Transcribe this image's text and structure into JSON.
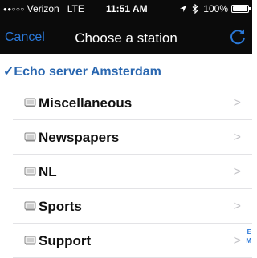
{
  "status_bar": {
    "signal_dots": "●●○○○",
    "carrier": "Verizon",
    "network": "LTE",
    "time": "11:51 AM",
    "location_icon": "location-arrow-icon",
    "bluetooth_icon": "bluetooth-icon",
    "battery": "100%",
    "battery_level": 1.0
  },
  "nav": {
    "cancel_label": "Cancel",
    "title": "Choose a station",
    "refresh_icon": "refresh-icon"
  },
  "group": {
    "checkmark": "✓",
    "title": "Echo server Amsterdam"
  },
  "items": [
    {
      "label": "Miscellaneous"
    },
    {
      "label": "Newspapers"
    },
    {
      "label": "NL"
    },
    {
      "label": "Sports"
    },
    {
      "label": "Support"
    }
  ],
  "chevron": ">",
  "section_index": [
    "E",
    "M"
  ],
  "colors": {
    "accent": "#2a78d8",
    "group_text": "#2a67b0",
    "header_bg": "#0b0b0b"
  }
}
